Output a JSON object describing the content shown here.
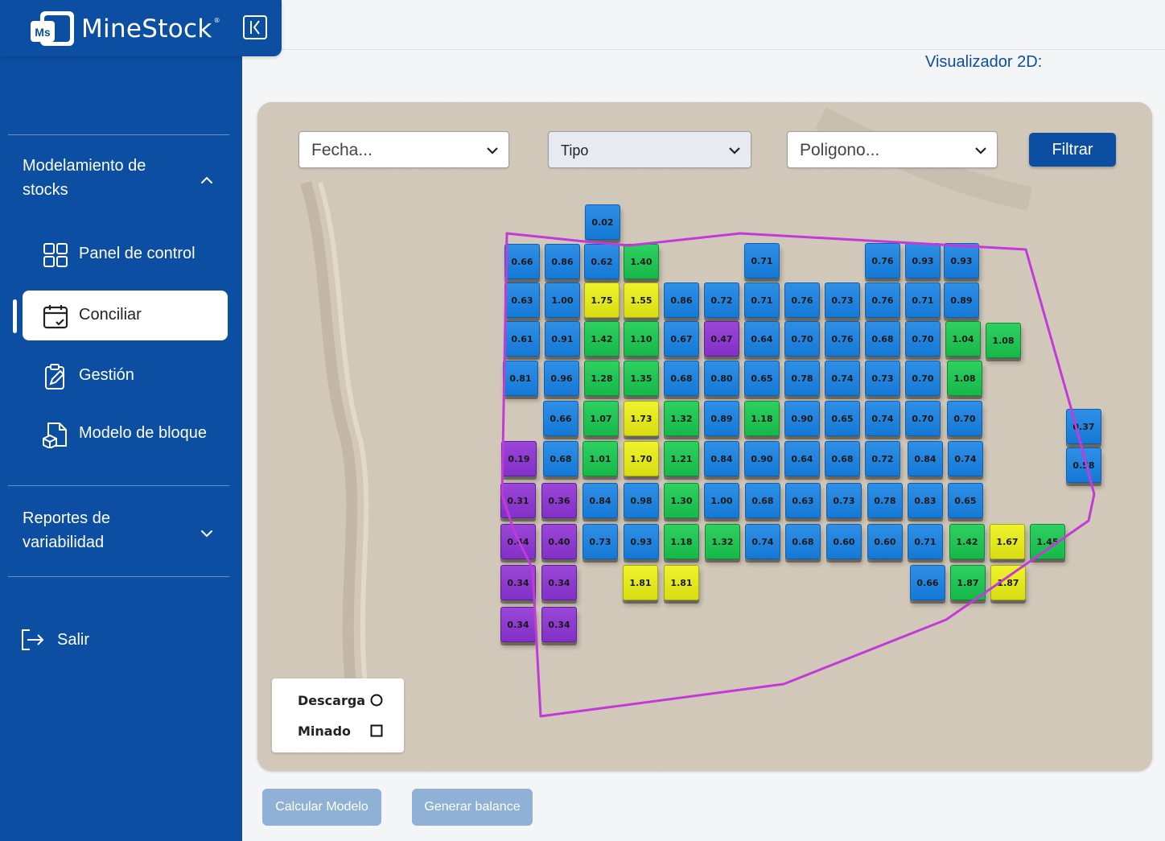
{
  "app": {
    "name": "MineStock",
    "logo_initials": "Ms",
    "registered_mark": "®"
  },
  "sidebar": {
    "sections": [
      {
        "label": "Modelamiento de stocks",
        "expanded": true
      },
      {
        "label": "Reportes de variabilidad",
        "expanded": false
      }
    ],
    "items": [
      {
        "label": "Panel de control",
        "icon": "grid-icon",
        "active": false
      },
      {
        "label": "Conciliar",
        "icon": "calendar-check-icon",
        "active": true
      },
      {
        "label": "Gestión",
        "icon": "clipboard-edit-icon",
        "active": false
      },
      {
        "label": "Modelo de bloque",
        "icon": "document-cube-icon",
        "active": false
      }
    ],
    "logout_label": "Salir"
  },
  "header": {
    "view_title": "Visualizador 2D:"
  },
  "filters": {
    "fecha_placeholder": "Fecha...",
    "tipo_placeholder": "Tipo",
    "poligono_placeholder": "Poligono...",
    "filter_button": "Filtrar"
  },
  "legend": {
    "items": [
      {
        "label": "Descarga",
        "symbol": "circle-icon"
      },
      {
        "label": "Minado",
        "symbol": "square-icon"
      }
    ]
  },
  "colors": {
    "brand": "#0b4ea2",
    "blue_block": "#1a80dc",
    "green_block": "#1ec452",
    "yellow_block": "#e2e81a",
    "purple_block": "#8a36cc",
    "polygon": "#c23ad8"
  },
  "blocks": [
    {
      "v": "0.02",
      "c": "blue"
    },
    {
      "v": "0.66",
      "c": "blue"
    },
    {
      "v": "0.86",
      "c": "blue"
    },
    {
      "v": "0.62",
      "c": "blue"
    },
    {
      "v": "1.40",
      "c": "green"
    },
    {
      "v": "0.71",
      "c": "blue"
    },
    {
      "v": "0.76",
      "c": "blue"
    },
    {
      "v": "0.93",
      "c": "blue"
    },
    {
      "v": "0.93",
      "c": "blue"
    },
    {
      "v": "0.63",
      "c": "blue"
    },
    {
      "v": "1.00",
      "c": "blue"
    },
    {
      "v": "1.75",
      "c": "yellow"
    },
    {
      "v": "1.55",
      "c": "yellow"
    },
    {
      "v": "0.86",
      "c": "blue"
    },
    {
      "v": "0.72",
      "c": "blue"
    },
    {
      "v": "0.71",
      "c": "blue"
    },
    {
      "v": "0.76",
      "c": "blue"
    },
    {
      "v": "0.73",
      "c": "blue"
    },
    {
      "v": "0.76",
      "c": "blue"
    },
    {
      "v": "0.71",
      "c": "blue"
    },
    {
      "v": "0.89",
      "c": "blue"
    },
    {
      "v": "0.61",
      "c": "blue"
    },
    {
      "v": "0.91",
      "c": "blue"
    },
    {
      "v": "1.42",
      "c": "green"
    },
    {
      "v": "1.10",
      "c": "green"
    },
    {
      "v": "0.67",
      "c": "blue"
    },
    {
      "v": "0.47",
      "c": "purple"
    },
    {
      "v": "0.64",
      "c": "blue"
    },
    {
      "v": "0.70",
      "c": "blue"
    },
    {
      "v": "0.76",
      "c": "blue"
    },
    {
      "v": "0.68",
      "c": "blue"
    },
    {
      "v": "0.70",
      "c": "blue"
    },
    {
      "v": "1.04",
      "c": "green"
    },
    {
      "v": "1.08",
      "c": "green"
    },
    {
      "v": "0.81",
      "c": "blue"
    },
    {
      "v": "0.96",
      "c": "blue"
    },
    {
      "v": "1.28",
      "c": "green"
    },
    {
      "v": "1.35",
      "c": "green"
    },
    {
      "v": "0.68",
      "c": "blue"
    },
    {
      "v": "0.80",
      "c": "blue"
    },
    {
      "v": "0.65",
      "c": "blue"
    },
    {
      "v": "0.78",
      "c": "blue"
    },
    {
      "v": "0.74",
      "c": "blue"
    },
    {
      "v": "0.73",
      "c": "blue"
    },
    {
      "v": "0.70",
      "c": "blue"
    },
    {
      "v": "1.08",
      "c": "green"
    },
    {
      "v": "0.66",
      "c": "blue"
    },
    {
      "v": "1.07",
      "c": "green"
    },
    {
      "v": "1.73",
      "c": "yellow"
    },
    {
      "v": "1.32",
      "c": "green"
    },
    {
      "v": "0.89",
      "c": "blue"
    },
    {
      "v": "1.18",
      "c": "green"
    },
    {
      "v": "0.90",
      "c": "blue"
    },
    {
      "v": "0.65",
      "c": "blue"
    },
    {
      "v": "0.74",
      "c": "blue"
    },
    {
      "v": "0.70",
      "c": "blue"
    },
    {
      "v": "0.70",
      "c": "blue"
    },
    {
      "v": "0.37",
      "c": "blue"
    },
    {
      "v": "0.19",
      "c": "purple"
    },
    {
      "v": "0.68",
      "c": "blue"
    },
    {
      "v": "1.01",
      "c": "green"
    },
    {
      "v": "1.70",
      "c": "yellow"
    },
    {
      "v": "1.21",
      "c": "green"
    },
    {
      "v": "0.84",
      "c": "blue"
    },
    {
      "v": "0.90",
      "c": "blue"
    },
    {
      "v": "0.64",
      "c": "blue"
    },
    {
      "v": "0.68",
      "c": "blue"
    },
    {
      "v": "0.72",
      "c": "blue"
    },
    {
      "v": "0.84",
      "c": "blue"
    },
    {
      "v": "0.74",
      "c": "blue"
    },
    {
      "v": "0.58",
      "c": "blue"
    },
    {
      "v": "0.31",
      "c": "purple"
    },
    {
      "v": "0.36",
      "c": "purple"
    },
    {
      "v": "0.84",
      "c": "blue"
    },
    {
      "v": "0.98",
      "c": "blue"
    },
    {
      "v": "1.30",
      "c": "green"
    },
    {
      "v": "1.00",
      "c": "blue"
    },
    {
      "v": "0.68",
      "c": "blue"
    },
    {
      "v": "0.63",
      "c": "blue"
    },
    {
      "v": "0.73",
      "c": "blue"
    },
    {
      "v": "0.78",
      "c": "blue"
    },
    {
      "v": "0.83",
      "c": "blue"
    },
    {
      "v": "0.65",
      "c": "blue"
    },
    {
      "v": "0.44",
      "c": "purple"
    },
    {
      "v": "0.40",
      "c": "purple"
    },
    {
      "v": "0.73",
      "c": "blue"
    },
    {
      "v": "0.93",
      "c": "blue"
    },
    {
      "v": "1.18",
      "c": "green"
    },
    {
      "v": "1.32",
      "c": "green"
    },
    {
      "v": "0.74",
      "c": "blue"
    },
    {
      "v": "0.68",
      "c": "blue"
    },
    {
      "v": "0.60",
      "c": "blue"
    },
    {
      "v": "0.60",
      "c": "blue"
    },
    {
      "v": "0.71",
      "c": "blue"
    },
    {
      "v": "1.42",
      "c": "green"
    },
    {
      "v": "1.67",
      "c": "yellow"
    },
    {
      "v": "1.45",
      "c": "green"
    },
    {
      "v": "0.34",
      "c": "purple"
    },
    {
      "v": "0.34",
      "c": "purple"
    },
    {
      "v": "1.81",
      "c": "yellow"
    },
    {
      "v": "1.81",
      "c": "yellow"
    },
    {
      "v": "0.66",
      "c": "blue"
    },
    {
      "v": "1.87",
      "c": "green"
    },
    {
      "v": "1.87",
      "c": "yellow"
    },
    {
      "v": "0.34",
      "c": "purple"
    },
    {
      "v": "0.34",
      "c": "purple"
    }
  ],
  "actions": {
    "calcular": "Calcular Modelo",
    "generar": "Generar balance"
  }
}
